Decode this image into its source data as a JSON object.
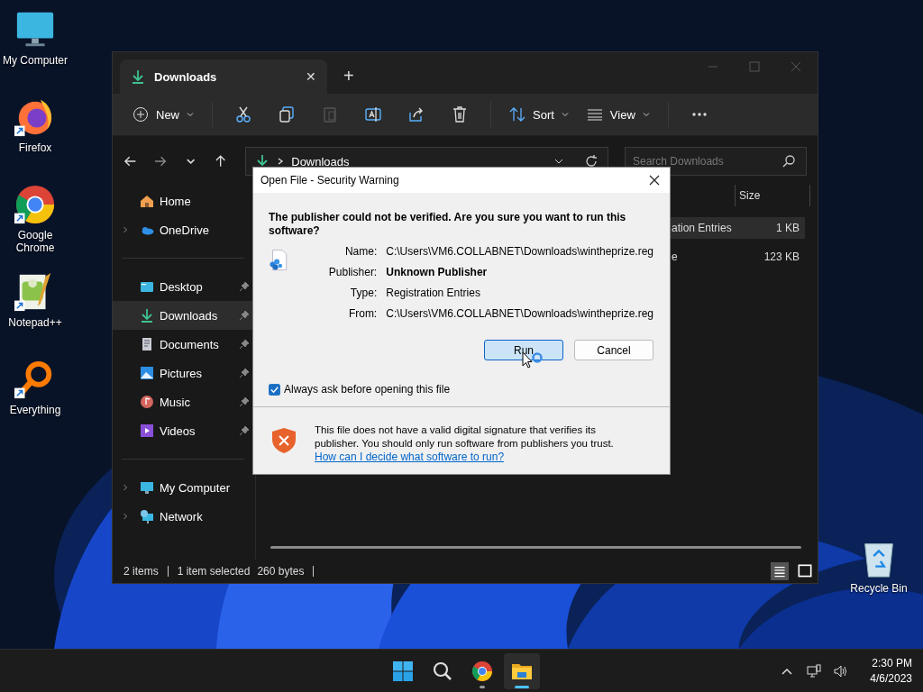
{
  "desktop_icons": [
    {
      "label": "My Computer",
      "kind": "computer",
      "shortcut": false
    },
    {
      "label": "Firefox",
      "kind": "firefox",
      "shortcut": true
    },
    {
      "label": "Google Chrome",
      "kind": "chrome",
      "shortcut": true
    },
    {
      "label": "Notepad++",
      "kind": "notepad",
      "shortcut": true
    },
    {
      "label": "Everything",
      "kind": "everything",
      "shortcut": true
    }
  ],
  "recycle_bin": {
    "label": "Recycle Bin"
  },
  "explorer": {
    "tab": {
      "title": "Downloads",
      "close": "✕"
    },
    "new_tab": "+",
    "toolbar": {
      "new": "New",
      "sort": "Sort",
      "view": "View"
    },
    "address": {
      "path": "Downloads"
    },
    "search": {
      "placeholder": "Search Downloads"
    },
    "sidebar": [
      [
        {
          "label": "Home",
          "kind": "home",
          "expandable": false,
          "pinned": false,
          "selected": false
        },
        {
          "label": "OneDrive",
          "kind": "cloud",
          "expandable": true,
          "pinned": false,
          "selected": false
        }
      ],
      [
        {
          "label": "Desktop",
          "kind": "desktop",
          "expandable": false,
          "pinned": true,
          "selected": false
        },
        {
          "label": "Downloads",
          "kind": "downloads",
          "expandable": false,
          "pinned": true,
          "selected": true
        },
        {
          "label": "Documents",
          "kind": "documents",
          "expandable": false,
          "pinned": true,
          "selected": false
        },
        {
          "label": "Pictures",
          "kind": "pictures",
          "expandable": false,
          "pinned": true,
          "selected": false
        },
        {
          "label": "Music",
          "kind": "music",
          "expandable": false,
          "pinned": true,
          "selected": false
        },
        {
          "label": "Videos",
          "kind": "videos",
          "expandable": false,
          "pinned": true,
          "selected": false
        }
      ],
      [
        {
          "label": "My Computer",
          "kind": "computer",
          "expandable": true,
          "pinned": false,
          "selected": false
        },
        {
          "label": "Network",
          "kind": "network",
          "expandable": true,
          "pinned": false,
          "selected": false
        }
      ]
    ],
    "columns": [
      {
        "label": "Size"
      }
    ],
    "rows": [
      {
        "type": "ation Entries",
        "size": "1 KB",
        "selected": true
      },
      {
        "type": "e",
        "size": "123 KB",
        "selected": false
      }
    ],
    "status": {
      "items": "2 items",
      "selection": "1 item selected",
      "size": "260 bytes"
    },
    "view_buttons": [
      {
        "kind": "details",
        "selected": true
      },
      {
        "kind": "tiles",
        "selected": false
      }
    ]
  },
  "dialog": {
    "title": "Open File - Security Warning",
    "question": "The publisher could not be verified.  Are you sure you want to run this software?",
    "fields": [
      {
        "label": "Name:",
        "value": "C:\\Users\\VM6.COLLABNET\\Downloads\\wintheprize.reg",
        "bold": false
      },
      {
        "label": "Publisher:",
        "value": "Unknown Publisher",
        "bold": true
      },
      {
        "label": "Type:",
        "value": "Registration Entries",
        "bold": false
      },
      {
        "label": "From:",
        "value": "C:\\Users\\VM6.COLLABNET\\Downloads\\wintheprize.reg",
        "bold": false
      }
    ],
    "buttons": [
      {
        "label": "Run",
        "default": true
      },
      {
        "label": "Cancel",
        "default": false
      }
    ],
    "checkbox": {
      "label": "Always ask before opening this file",
      "checked": true
    },
    "warning": "This file does not have a valid digital signature that verifies its publisher.  You should only run software from publishers you trust.",
    "link": "How can I decide what software to run?"
  },
  "taskbar": {
    "apps": [
      {
        "kind": "start",
        "running": false
      },
      {
        "kind": "search",
        "running": false
      },
      {
        "kind": "chrome",
        "running": true
      },
      {
        "kind": "folder",
        "running": true
      }
    ],
    "time": "2:30 PM",
    "date": "4/6/2023"
  }
}
